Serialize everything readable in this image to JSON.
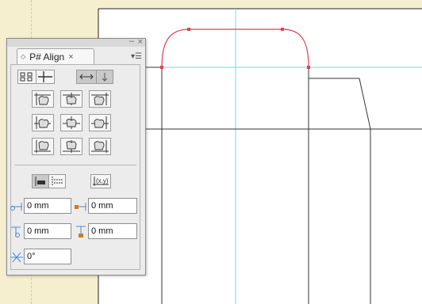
{
  "panel": {
    "tab_title": "P# Align",
    "tab_arrows": "◇",
    "tab_close": "×",
    "close_glyph": "×",
    "minimize_glyph": "–",
    "menu_glyph": "▾☰"
  },
  "fields": {
    "x_offset": "0 mm",
    "x_spacing": "0 mm",
    "y_offset": "0 mm",
    "y_spacing": "0 mm",
    "angle": "0°"
  },
  "icons": {
    "align_mode_left": "align-to-selection-icon",
    "align_mode_right": "align-to-key-object-icon",
    "distribute_horizontal": "horizontal-arrow-icon",
    "distribute_vertical": "vertical-arrow-icon",
    "xy_button": "xy-reference-icon"
  },
  "colors": {
    "curve": "#e04050",
    "guide": "#7fd4e0",
    "canvas_line": "#222222",
    "pasteboard": "#f5eecf"
  }
}
